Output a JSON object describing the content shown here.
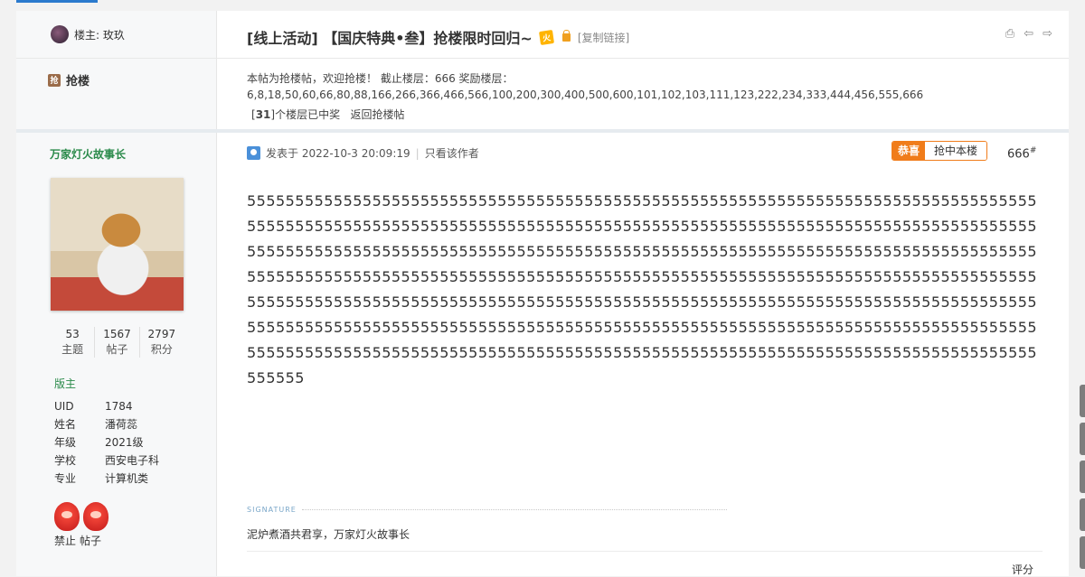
{
  "header": {
    "owner_label": "楼主: 玫玖",
    "title": "[线上活动] 【国庆特典•叁】抢楼限时回归~",
    "hot_badge": "火",
    "copy_link": "[复制链接]",
    "icons": [
      "print-icon",
      "prev-thread-icon",
      "next-thread-icon"
    ]
  },
  "rush": {
    "label": "抢楼",
    "badge": "抢",
    "info_line1": "本帖为抢楼帖，欢迎抢楼！ 截止楼层：666  奖励楼层：",
    "info_line2": "6,8,18,50,60,66,80,88,166,266,366,466,566,100,200,300,400,500,600,101,102,103,111,123,222,234,333,444,456,555,666",
    "won_count": "31",
    "won_text": "个楼层已中奖",
    "back_link": "返回抢楼帖"
  },
  "author": {
    "name": "万家灯火故事长",
    "stats": [
      {
        "value": "53",
        "label": "主题"
      },
      {
        "value": "1567",
        "label": "帖子"
      },
      {
        "value": "2797",
        "label": "积分"
      }
    ],
    "rank": "版主",
    "info": [
      {
        "k": "UID",
        "v": "1784"
      },
      {
        "k": "姓名",
        "v": "潘荷蕊"
      },
      {
        "k": "年级",
        "v": "2021级"
      },
      {
        "k": "学校",
        "v": "西安电子科"
      },
      {
        "k": "专业",
        "v": "计算机类"
      }
    ],
    "forbid": "禁止",
    "posts_link": "帖子"
  },
  "post": {
    "posted_at": "发表于 2022-10-3 20:09:19",
    "only_author": "只看该作者",
    "prize_a": "恭喜",
    "prize_b": "抢中本楼",
    "floor": "666",
    "floor_sup": "#",
    "body": "5555555555555555555555555555555555555555555555555555555555555555555555555555555555555555555555555555555555555555555555555555555555555555555555555555555555555555555555555555555555555555555555555555555555555555555555555555555555555555555555555555555555555555555555555555555555555555555555555555555555555555555555555555555555555555555555555555555555555555555555555555555555555555555555555555555555555555555555555555555555555555555555555555555555555555555555555555555555555555555555555555555555555555555555555555555555555555555555555555555555555555555555555555555555555555555555555555",
    "signature_label": "SIGNATURE",
    "signature": "泥炉煮酒共君享，万家灯火故事长",
    "rate": "评分"
  }
}
